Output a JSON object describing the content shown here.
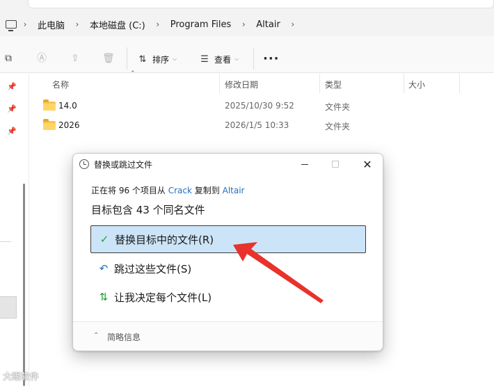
{
  "breadcrumb": {
    "items": [
      "此电脑",
      "本地磁盘 (C:)",
      "Program Files",
      "Altair"
    ]
  },
  "toolbar": {
    "sort_label": "排序",
    "view_label": "查看",
    "more_label": "···"
  },
  "columns": {
    "name": "名称",
    "date": "修改日期",
    "type": "类型",
    "size": "大小"
  },
  "files": [
    {
      "name": "14.0",
      "date": "2025/10/30 9:52",
      "type": "文件夹"
    },
    {
      "name": "2026",
      "date": "2026/1/5 10:33",
      "type": "文件夹"
    }
  ],
  "dialog": {
    "title": "替换或跳过文件",
    "status_prefix": "正在将 96 个项目从",
    "source": "Crack",
    "status_mid": "复制到",
    "destination": "Altair",
    "summary": "目标包含 43 个同名文件",
    "options": {
      "replace": "替换目标中的文件(R)",
      "skip": "跳过这些文件(S)",
      "decide": "让我决定每个文件(L)"
    },
    "details_label": "简略信息"
  },
  "watermark": "大眼软件",
  "colors": {
    "accent_link": "#1f6fbf",
    "selected_option": "#cce4f7",
    "check": "#1f9e3b",
    "arrow": "#e8322b",
    "folder": "#f7c54c"
  }
}
